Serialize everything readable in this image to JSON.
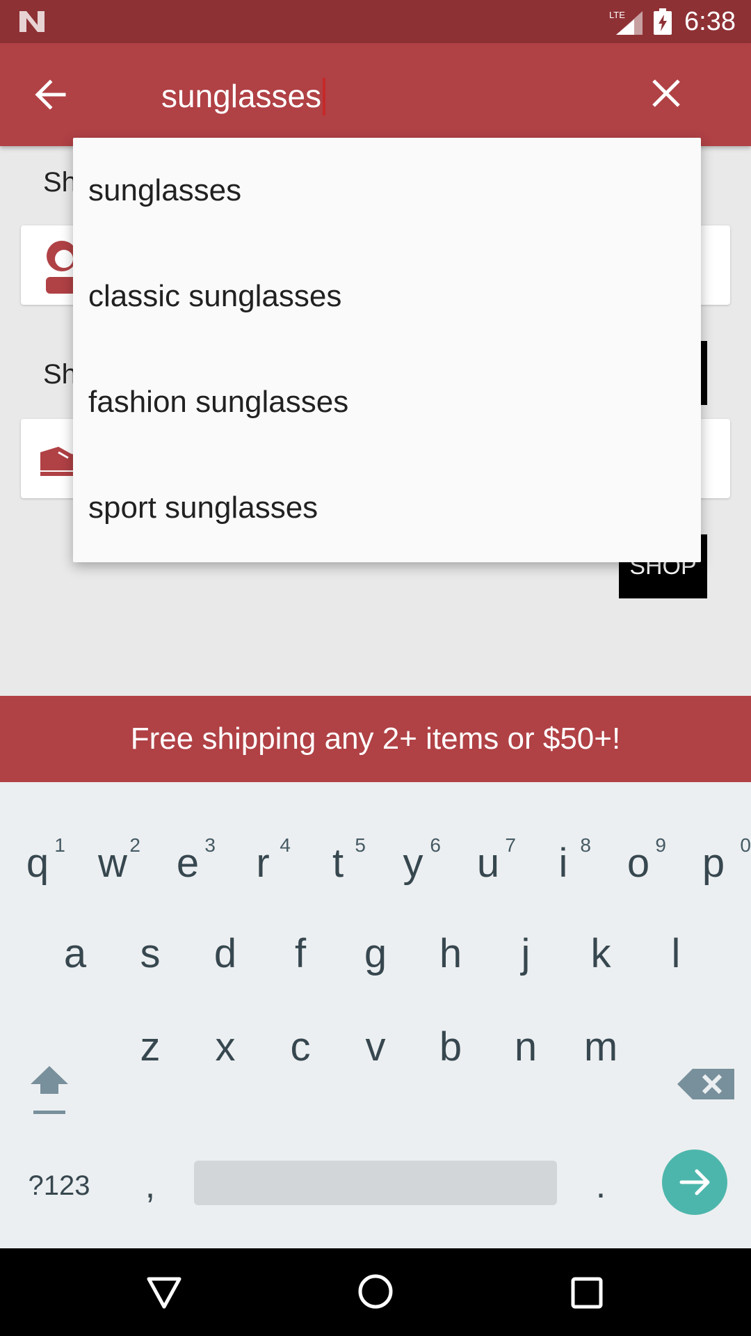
{
  "status_bar": {
    "time": "6:38",
    "network": "LTE"
  },
  "toolbar": {
    "query": "sunglasses"
  },
  "background": {
    "section_1_heading": "Sh",
    "section_2_heading": "Sh",
    "shop_label": "SHOP"
  },
  "suggestions": [
    "sunglasses",
    "classic sunglasses",
    "fashion sunglasses",
    "sport sunglasses"
  ],
  "promo": {
    "text": "Free shipping any 2+ items or $50+!"
  },
  "keyboard": {
    "row1": [
      "q",
      "w",
      "e",
      "r",
      "t",
      "y",
      "u",
      "i",
      "o",
      "p"
    ],
    "row1_hints": [
      "1",
      "2",
      "3",
      "4",
      "5",
      "6",
      "7",
      "8",
      "9",
      "0"
    ],
    "row2": [
      "a",
      "s",
      "d",
      "f",
      "g",
      "h",
      "j",
      "k",
      "l"
    ],
    "row3": [
      "z",
      "x",
      "c",
      "v",
      "b",
      "n",
      "m"
    ],
    "symbols_label": "?123",
    "comma": ",",
    "period": "."
  },
  "colors": {
    "accent": "#b04145",
    "status": "#8e3135",
    "enter": "#4db6ac"
  }
}
